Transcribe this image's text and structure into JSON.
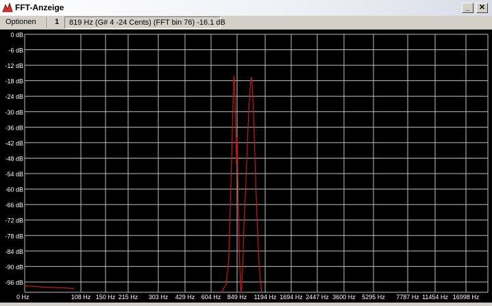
{
  "window": {
    "title": "FFT-Anzeige",
    "minimize_label": "_",
    "close_label": "✕"
  },
  "toolbar": {
    "options_label": "Optionen",
    "channel": "1",
    "readout": "819 Hz (G# 4 -24 Cents) (FFT bin 76) -16.1 dB"
  },
  "chart_data": {
    "type": "line",
    "title": "",
    "ylabel": "",
    "xlabel": "",
    "y_unit": "dB",
    "ylim": [
      -100,
      0
    ],
    "y_ticks": [
      0,
      -6,
      -12,
      -18,
      -24,
      -30,
      -36,
      -42,
      -48,
      -54,
      -60,
      -66,
      -72,
      -78,
      -84,
      -90,
      -96
    ],
    "x_scale": "log",
    "x_ticks": [
      "0 Hz",
      "108 Hz",
      "150 Hz",
      "215 Hz",
      "303 Hz",
      "429 Hz",
      "604 Hz",
      "849 Hz",
      "1194 Hz",
      "1694 Hz",
      "2447 Hz",
      "3600 Hz",
      "5295 Hz",
      "7787 Hz",
      "11454 Hz",
      "16998 Hz"
    ],
    "grid": true,
    "colors": {
      "background": "#000000",
      "grid": "#c0c0c0",
      "trace": "#c81818",
      "label": "#ffffff"
    },
    "series": [
      {
        "values": [
          [
            0,
            -97.5
          ],
          [
            40,
            -98
          ],
          [
            95,
            -98.5
          ],
          [
            700,
            -100
          ],
          [
            745,
            -97
          ],
          [
            770,
            -88
          ],
          [
            790,
            -60
          ],
          [
            805,
            -36
          ],
          [
            812,
            -24
          ],
          [
            816,
            -18
          ],
          [
            819,
            -16.1
          ],
          [
            823,
            -18
          ],
          [
            830,
            -26
          ],
          [
            843,
            -50
          ],
          [
            850,
            -40
          ],
          [
            860,
            -62
          ],
          [
            872,
            -80
          ],
          [
            885,
            -93
          ],
          [
            895,
            -100
          ],
          [
            905,
            -98
          ],
          [
            918,
            -90
          ],
          [
            935,
            -72
          ],
          [
            955,
            -60
          ],
          [
            975,
            -42
          ],
          [
            995,
            -28
          ],
          [
            1012,
            -20
          ],
          [
            1025,
            -16.5
          ],
          [
            1035,
            -20
          ],
          [
            1050,
            -30
          ],
          [
            1070,
            -50
          ],
          [
            1095,
            -72
          ],
          [
            1120,
            -90
          ],
          [
            1150,
            -100
          ]
        ]
      }
    ]
  }
}
